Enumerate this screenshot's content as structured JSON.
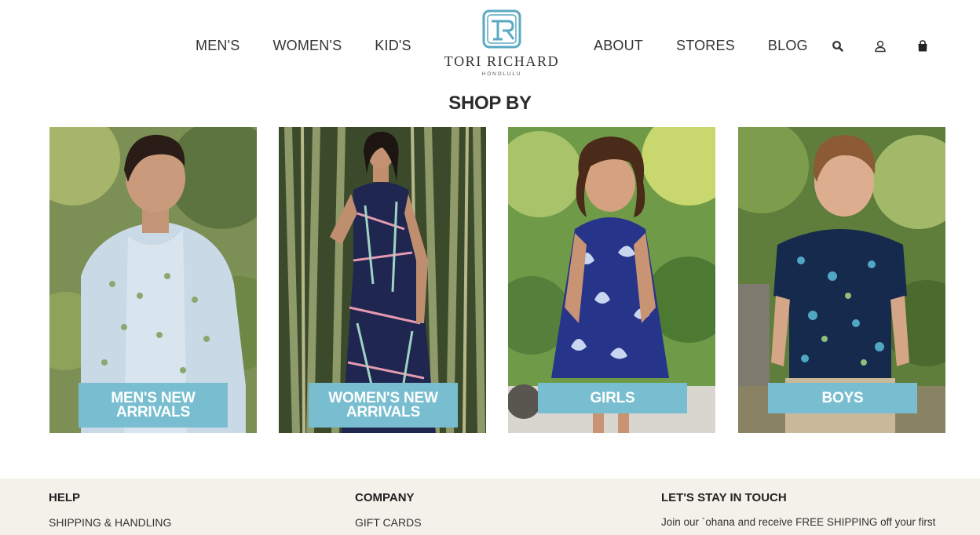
{
  "nav": {
    "left": [
      "MEN'S",
      "WOMEN'S",
      "KID'S"
    ],
    "right": [
      "ABOUT",
      "STORES",
      "BLOG"
    ]
  },
  "logo": {
    "name": "TORI RICHARD",
    "sub": "HONOLULU"
  },
  "icons": [
    "search-icon",
    "account-icon",
    "shopping-bag-icon"
  ],
  "colors": {
    "accent": "#78bed0",
    "footer_bg": "#f4f0ea",
    "logo_teal": "#5aa9c2"
  },
  "shop": {
    "title": "SHOP BY",
    "cards": [
      {
        "label": "MEN'S NEW ARRIVALS",
        "image": "man-in-light-blue-palm-print-shirt"
      },
      {
        "label": "WOMEN'S NEW ARRIVALS",
        "image": "woman-in-tropical-print-dress-bamboo"
      },
      {
        "label": "GIRLS",
        "image": "girl-in-blue-floral-dress"
      },
      {
        "label": "BOYS",
        "image": "boy-in-navy-aloha-shirt"
      }
    ]
  },
  "footer": {
    "help": {
      "heading": "HELP",
      "links": [
        "SHIPPING & HANDLING"
      ]
    },
    "company": {
      "heading": "COMPANY",
      "links": [
        "GIFT CARDS"
      ]
    },
    "touch": {
      "heading": "LET'S STAY IN TOUCH",
      "text": "Join our `ohana and receive FREE SHIPPING off your first"
    }
  }
}
